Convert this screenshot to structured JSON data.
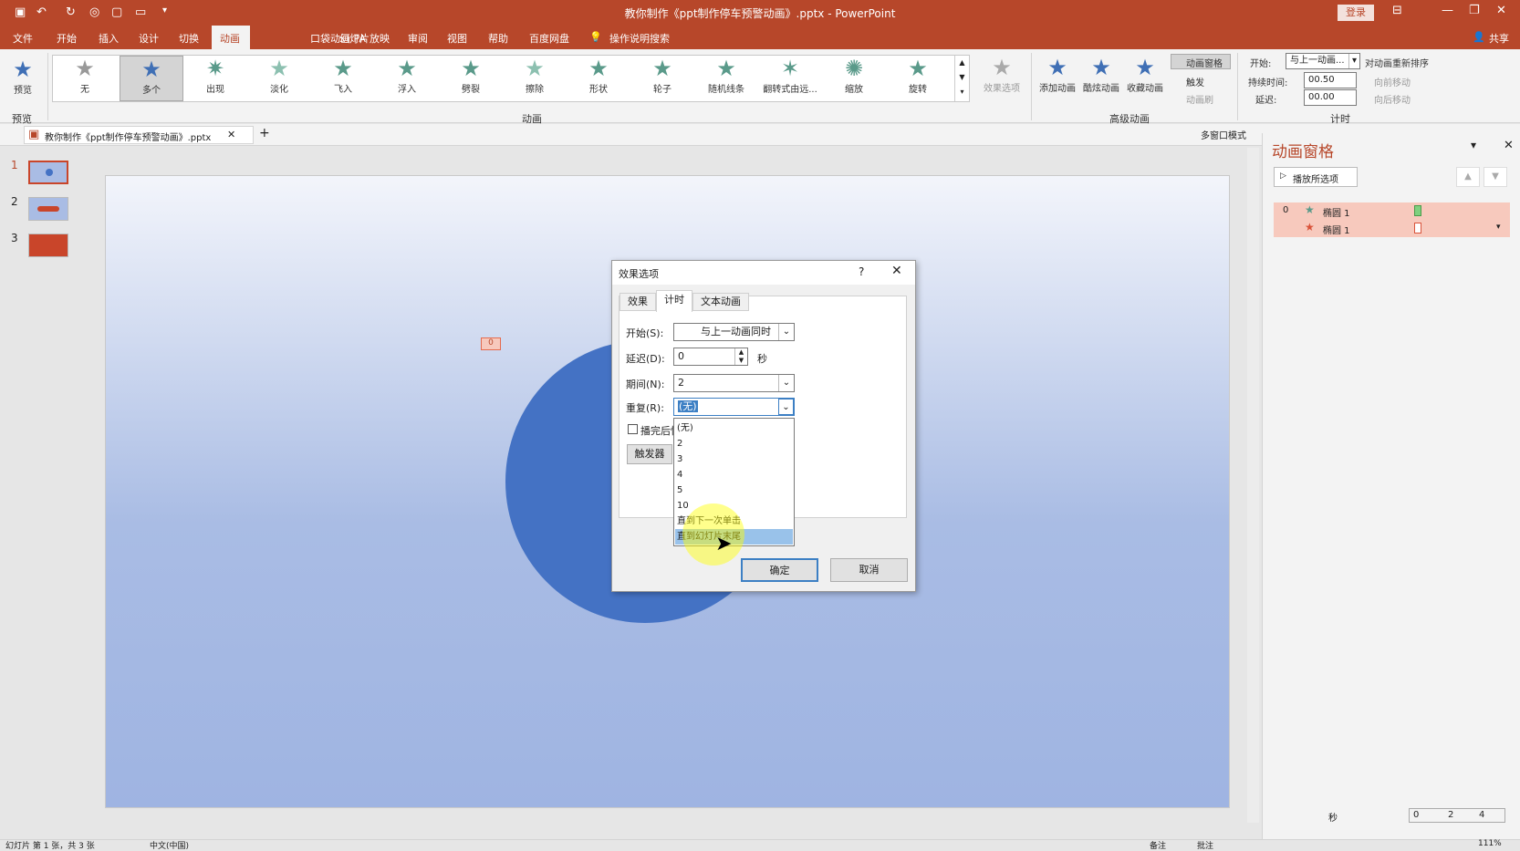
{
  "titlebar": {
    "title": "教你制作《ppt制作停车预警动画》.pptx - PowerPoint",
    "login": "登录"
  },
  "menu": [
    "文件",
    "开始",
    "插入",
    "设计",
    "切换",
    "动画",
    "口袋动画 PA",
    "幻灯片放映",
    "审阅",
    "视图",
    "帮助",
    "百度网盘",
    "操作说明搜索"
  ],
  "menu_active": "动画",
  "share": "共享",
  "ribbon": {
    "preview": "预览",
    "preview_group": "预览",
    "animation_group": "动画",
    "effects": [
      "无",
      "多个",
      "出现",
      "淡化",
      "飞入",
      "浮入",
      "劈裂",
      "擦除",
      "形状",
      "轮子",
      "随机线条",
      "翻转式由远...",
      "缩放",
      "旋转"
    ],
    "selected_effect": "多个",
    "effect_options": "效果选项",
    "add_animation": "添加动画",
    "dazzle_animation": "酷炫动画",
    "collect_animation": "收藏动画",
    "animation_pane_btn": "动画窗格",
    "trigger": "触发",
    "animation_brush": "动画刷",
    "advanced_group": "高级动画",
    "start_label": "开始:",
    "start_value": "与上一动画...",
    "duration_label": "持续时间:",
    "duration_value": "00.50",
    "delay_label": "延迟:",
    "delay_value": "00.00",
    "reorder": "对动画重新排序",
    "move_earlier": "向前移动",
    "move_later": "向后移动",
    "timing_group": "计时"
  },
  "doc_tab": {
    "name": "教你制作《ppt制作停车预警动画》.pptx",
    "multi_window": "多窗口模式"
  },
  "slides": [
    {
      "num": "1"
    },
    {
      "num": "2"
    },
    {
      "num": "3"
    }
  ],
  "slide_tag": "0",
  "anim_pane": {
    "title": "动画窗格",
    "play_selected": "播放所选项",
    "items": [
      {
        "index": "0",
        "name": "椭圆 1"
      },
      {
        "index": "",
        "name": "椭圆 1"
      }
    ],
    "seconds": "秒",
    "timeline": [
      "0",
      "2",
      "4"
    ]
  },
  "dialog": {
    "title": "效果选项",
    "help": "?",
    "tabs": [
      "效果",
      "计时",
      "文本动画"
    ],
    "active_tab": "计时",
    "start_label": "开始(S):",
    "start_value": "与上一动画同时",
    "delay_label": "延迟(D):",
    "delay_value": "0",
    "delay_unit": "秒",
    "period_label": "期间(N):",
    "period_value": "2",
    "repeat_label": "重复(R):",
    "repeat_value": "(无)",
    "rewind_label": "播完后快",
    "trigger_btn": "触发器(T)",
    "repeat_options": [
      "(无)",
      "2",
      "3",
      "4",
      "5",
      "10",
      "直到下一次单击",
      "直到幻灯片末尾"
    ],
    "highlighted_option": "直到幻灯片末尾",
    "ok": "确定",
    "cancel": "取消"
  },
  "status": {
    "slide_info": "幻灯片 第 1 张，共 3 张",
    "lang": "中文(中国)",
    "notes": "备注",
    "comments": "批注",
    "zoom": "111%"
  }
}
